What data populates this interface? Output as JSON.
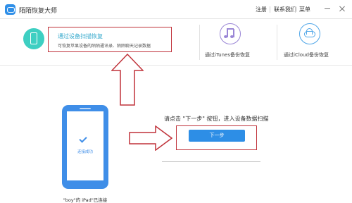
{
  "app": {
    "title": "陌陌恢复大师",
    "logo_icon": "chat-bubble-icon"
  },
  "menu": {
    "register": "注册",
    "contact": "联系我们",
    "main_menu": "菜单"
  },
  "window_controls": {
    "minimize_icon": "minimize-icon",
    "close_icon": "close-icon"
  },
  "modes": {
    "device": {
      "title": "通过设备扫描恢复",
      "description": "可恢复苹果设备的陌陌通讯录、陌陌聊天记录数据",
      "icon": "phone-icon",
      "color": "#3ecfc2",
      "selected": true
    },
    "itunes": {
      "label": "通过iTunes备份恢复",
      "icon": "music-note-icon",
      "color": "#9a86d6"
    },
    "icloud": {
      "label": "通过iCloud备份恢复",
      "icon": "cloud-icon",
      "color": "#4fa6e8"
    }
  },
  "main": {
    "phone_status": "连接成功",
    "device_caption": "\"boy\"的 iPad\"已连接",
    "instruction": "请点击 \"下一步\" 按钮，进入设备数据扫描",
    "next_button": "下一步"
  },
  "colors": {
    "accent": "#2d8ee6",
    "highlight": "#c0323a",
    "teal": "#3ecfc2"
  }
}
